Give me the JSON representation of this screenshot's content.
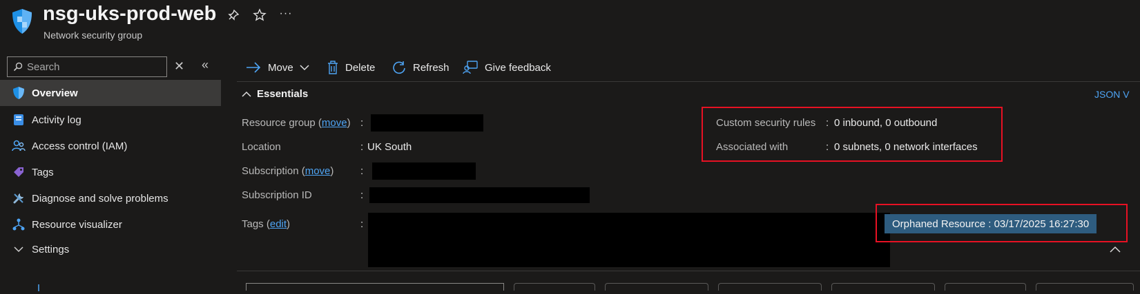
{
  "header": {
    "title": "nsg-uks-prod-web",
    "subtitle": "Network security group",
    "more_label": "···"
  },
  "sidebar": {
    "search": {
      "placeholder": "Search"
    },
    "items": [
      {
        "label": "Overview",
        "icon": "shield-icon"
      },
      {
        "label": "Activity log",
        "icon": "activity-log-icon"
      },
      {
        "label": "Access control (IAM)",
        "icon": "people-icon"
      },
      {
        "label": "Tags",
        "icon": "tag-icon"
      },
      {
        "label": "Diagnose and solve problems",
        "icon": "wrench-icon"
      },
      {
        "label": "Resource visualizer",
        "icon": "diagram-icon"
      },
      {
        "label": "Settings",
        "icon": "chevron-down-icon"
      }
    ]
  },
  "toolbar": {
    "move_label": "Move",
    "delete_label": "Delete",
    "refresh_label": "Refresh",
    "feedback_label": "Give feedback"
  },
  "essentials": {
    "title": "Essentials",
    "json_view_label": "JSON V",
    "resource_group_label": "Resource group",
    "move_link": "move",
    "location_label": "Location",
    "location_value": "UK South",
    "subscription_label": "Subscription",
    "subscription_id_label": "Subscription ID",
    "tags_label": "Tags",
    "edit_link": "edit",
    "custom_rules_label": "Custom security rules",
    "custom_rules_value": "0 inbound, 0 outbound",
    "associated_label": "Associated with",
    "associated_value": "0 subnets, 0 network interfaces",
    "orphan_tag": "Orphaned Resource : 03/17/2025 16:27:30"
  },
  "colors": {
    "background": "#1b1a19",
    "accent": "#4ea4f4",
    "highlight_border": "#e81123",
    "tag_background": "#2e5c7f",
    "selected_nav": "#3b3a39"
  }
}
